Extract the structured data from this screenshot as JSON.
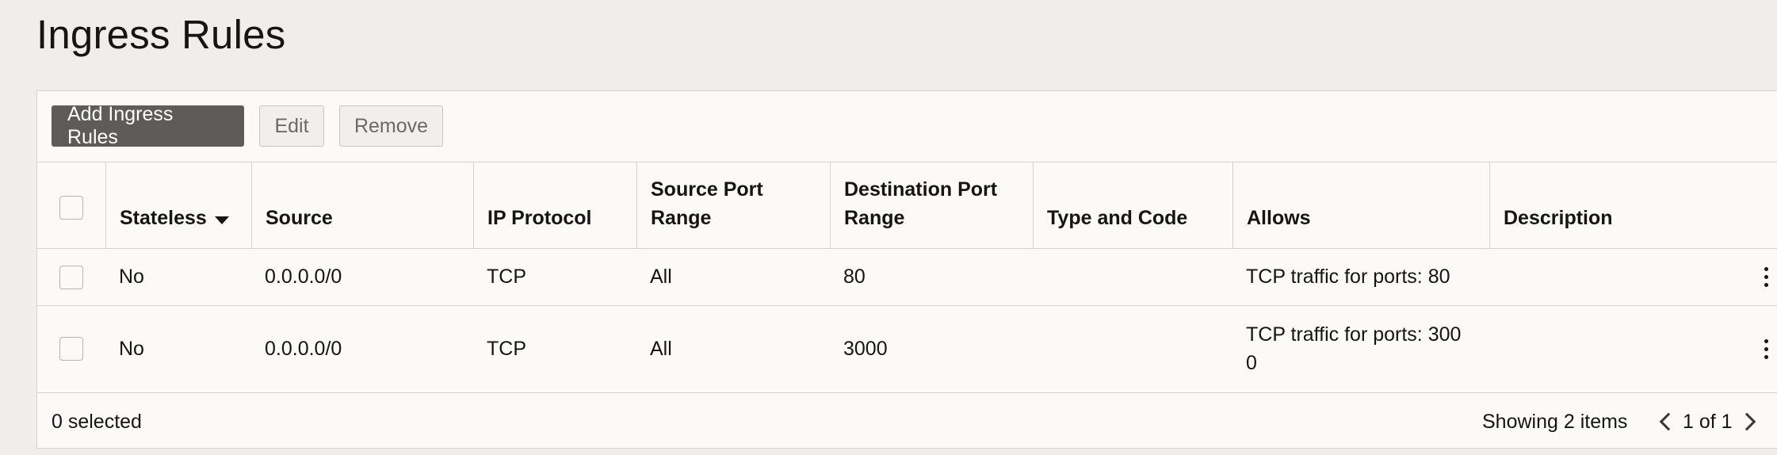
{
  "page": {
    "title": "Ingress Rules"
  },
  "toolbar": {
    "add_label": "Add Ingress Rules",
    "edit_label": "Edit",
    "remove_label": "Remove"
  },
  "table": {
    "columns": [
      "Stateless",
      "Source",
      "IP Protocol",
      "Source Port Range",
      "Destination Port Range",
      "Type and Code",
      "Allows",
      "Description"
    ],
    "header_lines": {
      "source_port_1": "Source Port",
      "source_port_2": "Range",
      "dest_port_1": "Destination Port",
      "dest_port_2": "Range"
    },
    "rows": [
      {
        "stateless": "No",
        "source": "0.0.0.0/0",
        "protocol": "TCP",
        "source_port": "All",
        "dest_port": "80",
        "type_code": "",
        "allows": "TCP traffic for ports: 80",
        "description": ""
      },
      {
        "stateless": "No",
        "source": "0.0.0.0/0",
        "protocol": "TCP",
        "source_port": "All",
        "dest_port": "3000",
        "type_code": "",
        "allows_line1": "TCP traffic for ports: 300",
        "allows_line2": "0",
        "description": ""
      }
    ]
  },
  "footer": {
    "selected": "0 selected",
    "showing": "Showing 2 items",
    "page": "1 of 1"
  },
  "icons": {
    "sort": "sort-desc-icon",
    "actions": "kebab-menu-icon",
    "prev": "chevron-left-icon",
    "next": "chevron-right-icon"
  }
}
